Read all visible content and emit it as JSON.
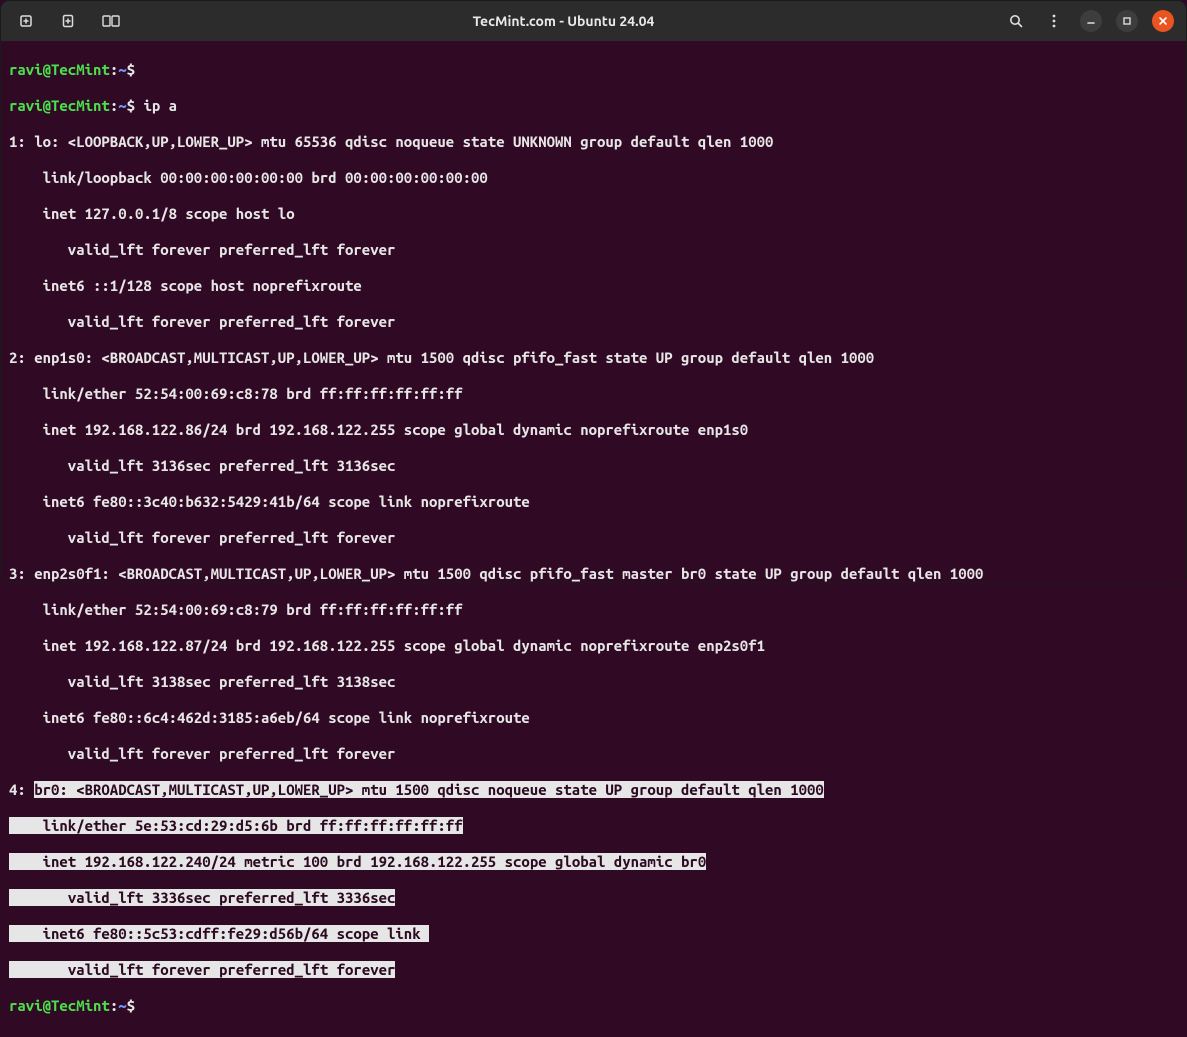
{
  "window": {
    "title": "TecMint.com - Ubuntu 24.04"
  },
  "prompt": {
    "user_host": "ravi@TecMint",
    "sep": ":",
    "path": "~",
    "sigil": "$"
  },
  "commands": {
    "ip_a": "ip a"
  },
  "output": {
    "lo_header": "1: lo: <LOOPBACK,UP,LOWER_UP> mtu 65536 qdisc noqueue state UNKNOWN group default qlen 1000",
    "lo_link": "    link/loopback 00:00:00:00:00:00 brd 00:00:00:00:00:00",
    "lo_inet": "    inet 127.0.0.1/8 scope host lo",
    "lo_valid": "       valid_lft forever preferred_lft forever",
    "lo_inet6": "    inet6 ::1/128 scope host noprefixroute ",
    "lo_valid6": "       valid_lft forever preferred_lft forever",
    "e1_header": "2: enp1s0: <BROADCAST,MULTICAST,UP,LOWER_UP> mtu 1500 qdisc pfifo_fast state UP group default qlen 1000",
    "e1_link": "    link/ether 52:54:00:69:c8:78 brd ff:ff:ff:ff:ff:ff",
    "e1_inet": "    inet 192.168.122.86/24 brd 192.168.122.255 scope global dynamic noprefixroute enp1s0",
    "e1_valid": "       valid_lft 3136sec preferred_lft 3136sec",
    "e1_inet6": "    inet6 fe80::3c40:b632:5429:41b/64 scope link noprefixroute ",
    "e1_valid6": "       valid_lft forever preferred_lft forever",
    "e2_header": "3: enp2s0f1: <BROADCAST,MULTICAST,UP,LOWER_UP> mtu 1500 qdisc pfifo_fast master br0 state UP group default qlen 1000",
    "e2_link": "    link/ether 52:54:00:69:c8:79 brd ff:ff:ff:ff:ff:ff",
    "e2_inet": "    inet 192.168.122.87/24 brd 192.168.122.255 scope global dynamic noprefixroute enp2s0f1",
    "e2_valid": "       valid_lft 3138sec preferred_lft 3138sec",
    "e2_inet6": "    inet6 fe80::6c4:462d:3185:a6eb/64 scope link noprefixroute ",
    "e2_valid6": "       valid_lft forever preferred_lft forever",
    "br_prefix": "4: ",
    "br_header": "br0: <BROADCAST,MULTICAST,UP,LOWER_UP> mtu 1500 qdisc noqueue state UP group default qlen 1000",
    "br_pad_link": "    ",
    "br_link": "link/ether 5e:53:cd:29:d5:6b brd ff:ff:ff:ff:ff:ff",
    "br_pad_inet": "    ",
    "br_inet": "inet 192.168.122.240/24 metric 100 brd 192.168.122.255 scope global dynamic br0",
    "br_pad_valid": "       ",
    "br_valid": "valid_lft 3336sec preferred_lft 3336sec",
    "br_pad_inet6": "    ",
    "br_inet6": "inet6 fe80::5c53:cdff:fe29:d56b/64 scope link ",
    "br_pad_valid6": "       ",
    "br_valid6": "valid_lft forever preferred_lft forever"
  }
}
